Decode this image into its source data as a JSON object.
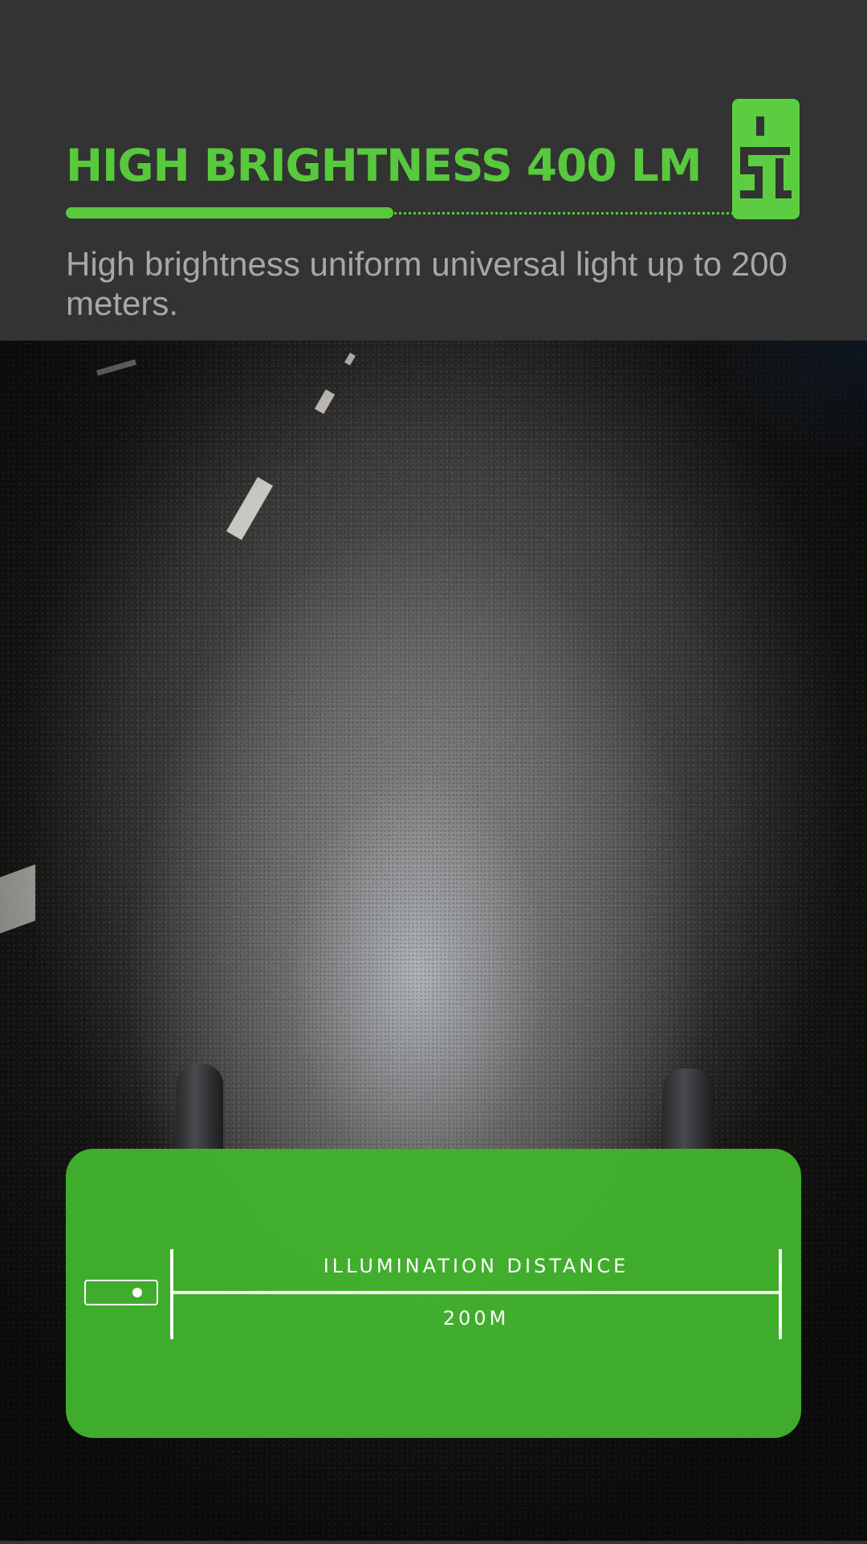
{
  "header": {
    "title": "HIGH BRIGHTNESS 400 LM",
    "subtitle": "High brightness uniform universal light up to 200 meters.",
    "progress_fraction": 0.49,
    "badge_icon": "light-mode-glyph-icon"
  },
  "panel": {
    "label": "ILLUMINATION DISTANCE",
    "value": "200M",
    "lamp_icon": "bike-light-icon"
  },
  "colors": {
    "background": "#333333",
    "accent": "#58c93c",
    "panel": "#42b22c",
    "subtitle_text": "#a7a7a7"
  }
}
